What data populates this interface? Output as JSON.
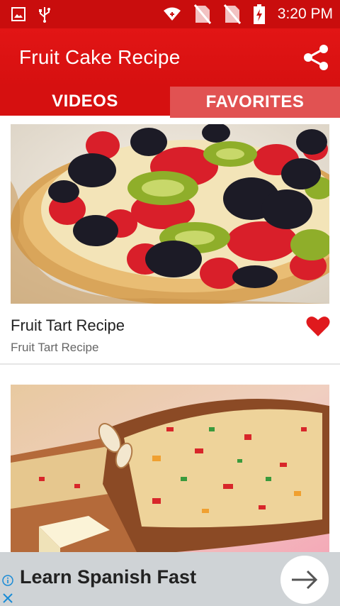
{
  "status_bar": {
    "time": "3:20 PM",
    "icons": [
      "image-icon",
      "usb-icon",
      "wifi-icon",
      "no-sim-icon",
      "no-sim-icon",
      "battery-charging-icon"
    ]
  },
  "app_bar": {
    "title": "Fruit Cake Recipe",
    "share_icon": "share-icon"
  },
  "tabs": [
    {
      "label": "VIDEOS",
      "active": true
    },
    {
      "label": "FAVORITES",
      "active": false
    }
  ],
  "videos": [
    {
      "title": "Fruit Tart Recipe",
      "subtitle": "Fruit Tart Recipe",
      "favorited": true
    },
    {
      "title": "",
      "subtitle": "",
      "favorited": false
    }
  ],
  "ad": {
    "text": "Learn Spanish Fast",
    "arrow_icon": "arrow-right-icon",
    "info_icon": "info-icon",
    "close_icon": "close-icon"
  },
  "colors": {
    "primary": "#d61010",
    "status_bar": "#c90d0d",
    "tab_inactive": "#e15252",
    "favorite_heart": "#e0191d",
    "ad_background": "#cfd3d6"
  }
}
